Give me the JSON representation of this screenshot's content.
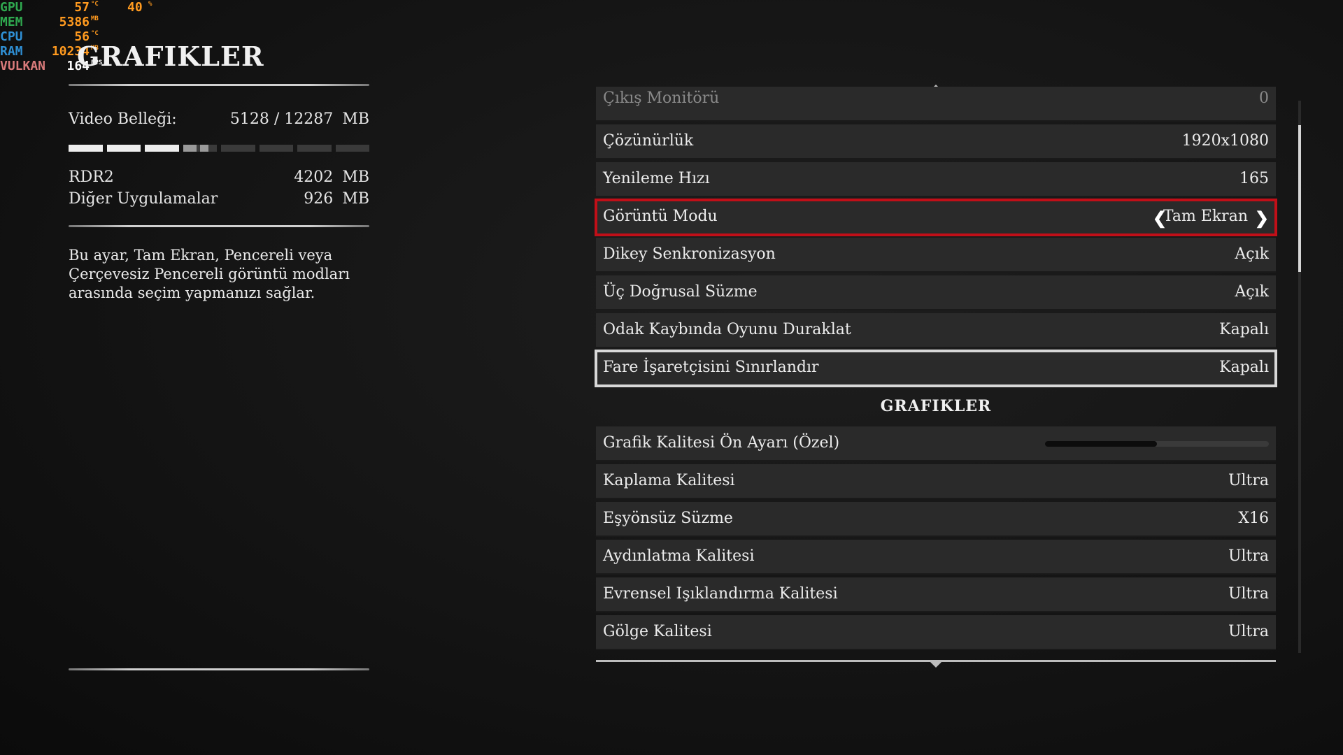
{
  "overlay": {
    "rows": [
      {
        "label": "GPU",
        "value": "57",
        "unit": "°C",
        "color": "#2fa84f",
        "extra": "40",
        "extra_unit": "%"
      },
      {
        "label": "MEM",
        "value": "5386",
        "unit": "MB",
        "color": "#2fa84f"
      },
      {
        "label": "CPU",
        "value": "56",
        "unit": "°C",
        "color": "#2f8fd4"
      },
      {
        "label": "RAM",
        "value": "10234",
        "unit": "MB",
        "color": "#2f8fd4"
      },
      {
        "label": "VULKAN",
        "value": "164",
        "unit": "FPS",
        "color": "#d97b7b"
      }
    ],
    "value_color": "#ff9a1f",
    "vulkan_value_color": "#ffffff"
  },
  "page": {
    "title": "GRAFIKLER"
  },
  "memory": {
    "label": "Video Belleği:",
    "used": "5128",
    "total": "/ 12287",
    "unit": "MB",
    "usage_fraction": 0.417,
    "items": [
      {
        "label": "RDR2",
        "value": "4202",
        "unit": "MB"
      },
      {
        "label": "Diğer Uygulamalar",
        "value": "926",
        "unit": "MB"
      }
    ]
  },
  "description": "Bu ayar, Tam Ekran, Pencereli veya Çerçevesiz Pencereli görüntü modları arasında seçim yapmanızı sağlar.",
  "settings": {
    "rows": [
      {
        "label": "Çıkış Monitörü",
        "value": "0",
        "state": "dim"
      },
      {
        "label": "Çözünürlük",
        "value": "1920x1080"
      },
      {
        "label": "Yenileme Hızı",
        "value": "165"
      },
      {
        "label": "Görüntü Modu",
        "value": "Tam Ekran",
        "state": "selected"
      },
      {
        "label": "Dikey Senkronizasyon",
        "value": "Açık"
      },
      {
        "label": "Üç Doğrusal Süzme",
        "value": "Açık"
      },
      {
        "label": "Odak Kaybında Oyunu Duraklat",
        "value": "Kapalı"
      },
      {
        "label": "Fare İşaretçisini Sınırlandır",
        "value": "Kapalı",
        "state": "hover"
      }
    ],
    "section": "GRAFIKLER",
    "graphics_rows": [
      {
        "label": "Grafik Kalitesi Ön Ayarı  (Özel)",
        "slider": 0.5
      },
      {
        "label": "Kaplama Kalitesi",
        "value": "Ultra"
      },
      {
        "label": "Eşyönsüz Süzme",
        "value": "X16"
      },
      {
        "label": "Aydınlatma Kalitesi",
        "value": "Ultra"
      },
      {
        "label": "Evrensel Işıklandırma Kalitesi",
        "value": "Ultra"
      },
      {
        "label": "Gölge Kalitesi",
        "value": "Ultra"
      }
    ]
  },
  "colors": {
    "selected_border": "#c10f18",
    "hover_border": "#d8d8d8"
  }
}
